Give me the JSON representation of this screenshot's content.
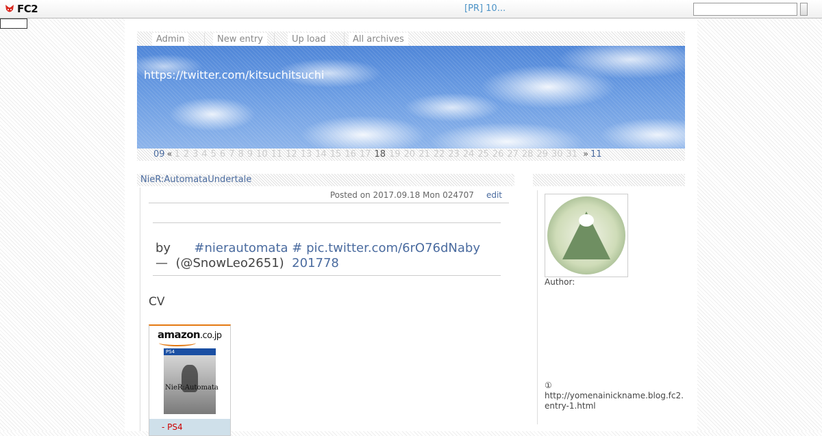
{
  "fc2bar": {
    "logo_text": "FC2",
    "pr_link": "[PR] 10...",
    "search_value": "",
    "search_button_label": ""
  },
  "menu": {
    "items": [
      {
        "label": "Admin"
      },
      {
        "label": "New entry"
      },
      {
        "label": "Up load"
      },
      {
        "label": "All archives"
      }
    ]
  },
  "header": {
    "blog_title": "https://twitter.com/kitsuchitsuchi"
  },
  "calendar": {
    "prev_month": "09",
    "prev_arrow": "«",
    "next_arrow": "»",
    "next_month": "11",
    "days": [
      "1",
      "2",
      "3",
      "4",
      "5",
      "6",
      "7",
      "8",
      "9",
      "10",
      "11",
      "12",
      "13",
      "14",
      "15",
      "16",
      "17",
      "18",
      "19",
      "20",
      "21",
      "22",
      "23",
      "24",
      "25",
      "26",
      "27",
      "28",
      "29",
      "30",
      "31"
    ],
    "selected_day": "18"
  },
  "entry": {
    "title": "NieR:AutomataUndertale",
    "posted": "Posted on 2017.09.18 Mon 024707",
    "edit_label": "edit",
    "tweet_by": "by",
    "tweet_hashtag": "#nierautomata # pic.twitter.com/6rO76dNaby",
    "tweet_dash": "—",
    "tweet_user": "(@SnowLeo2651)",
    "tweet_date": "201778",
    "cv_heading": "CV"
  },
  "amazon": {
    "logo": "amazon",
    "logo_suffix": ".co.jp",
    "cover_platform": "PS4",
    "cover_title": "NieR:Automata",
    "footer_text": "- PS4"
  },
  "sidebar": {
    "author_label": "Author:",
    "note_mark": "①",
    "note_url_1": "http://yomenainickname.blog.fc2.",
    "note_url_2": "entry-1.html"
  },
  "colors": {
    "link": "#4a6b9f",
    "amazon_orange": "#e47911",
    "amazon_footer": "#cfe0ea",
    "fc2_red": "#d9261c"
  }
}
